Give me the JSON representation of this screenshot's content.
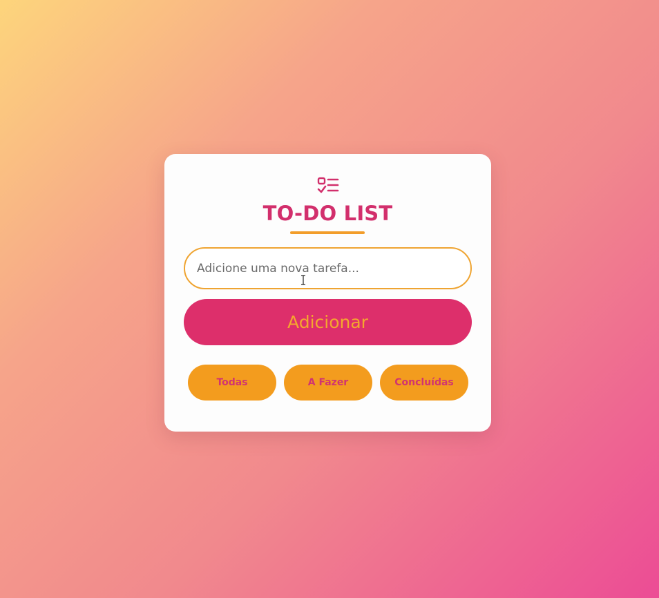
{
  "app": {
    "title": "TO-DO LIST",
    "logo_icon": "checklist-icon"
  },
  "input": {
    "placeholder": "Adicione uma nova tarefa...",
    "value": ""
  },
  "actions": {
    "add_label": "Adicionar"
  },
  "filters": {
    "all_label": "Todas",
    "todo_label": "A Fazer",
    "done_label": "Concluídas"
  },
  "colors": {
    "primary": "#dd2f6b",
    "accent": "#f39c1e",
    "title": "#d22f6c",
    "card": "#fdfdfd",
    "gradient_start": "#fdd57c",
    "gradient_end": "#ec4c95"
  }
}
